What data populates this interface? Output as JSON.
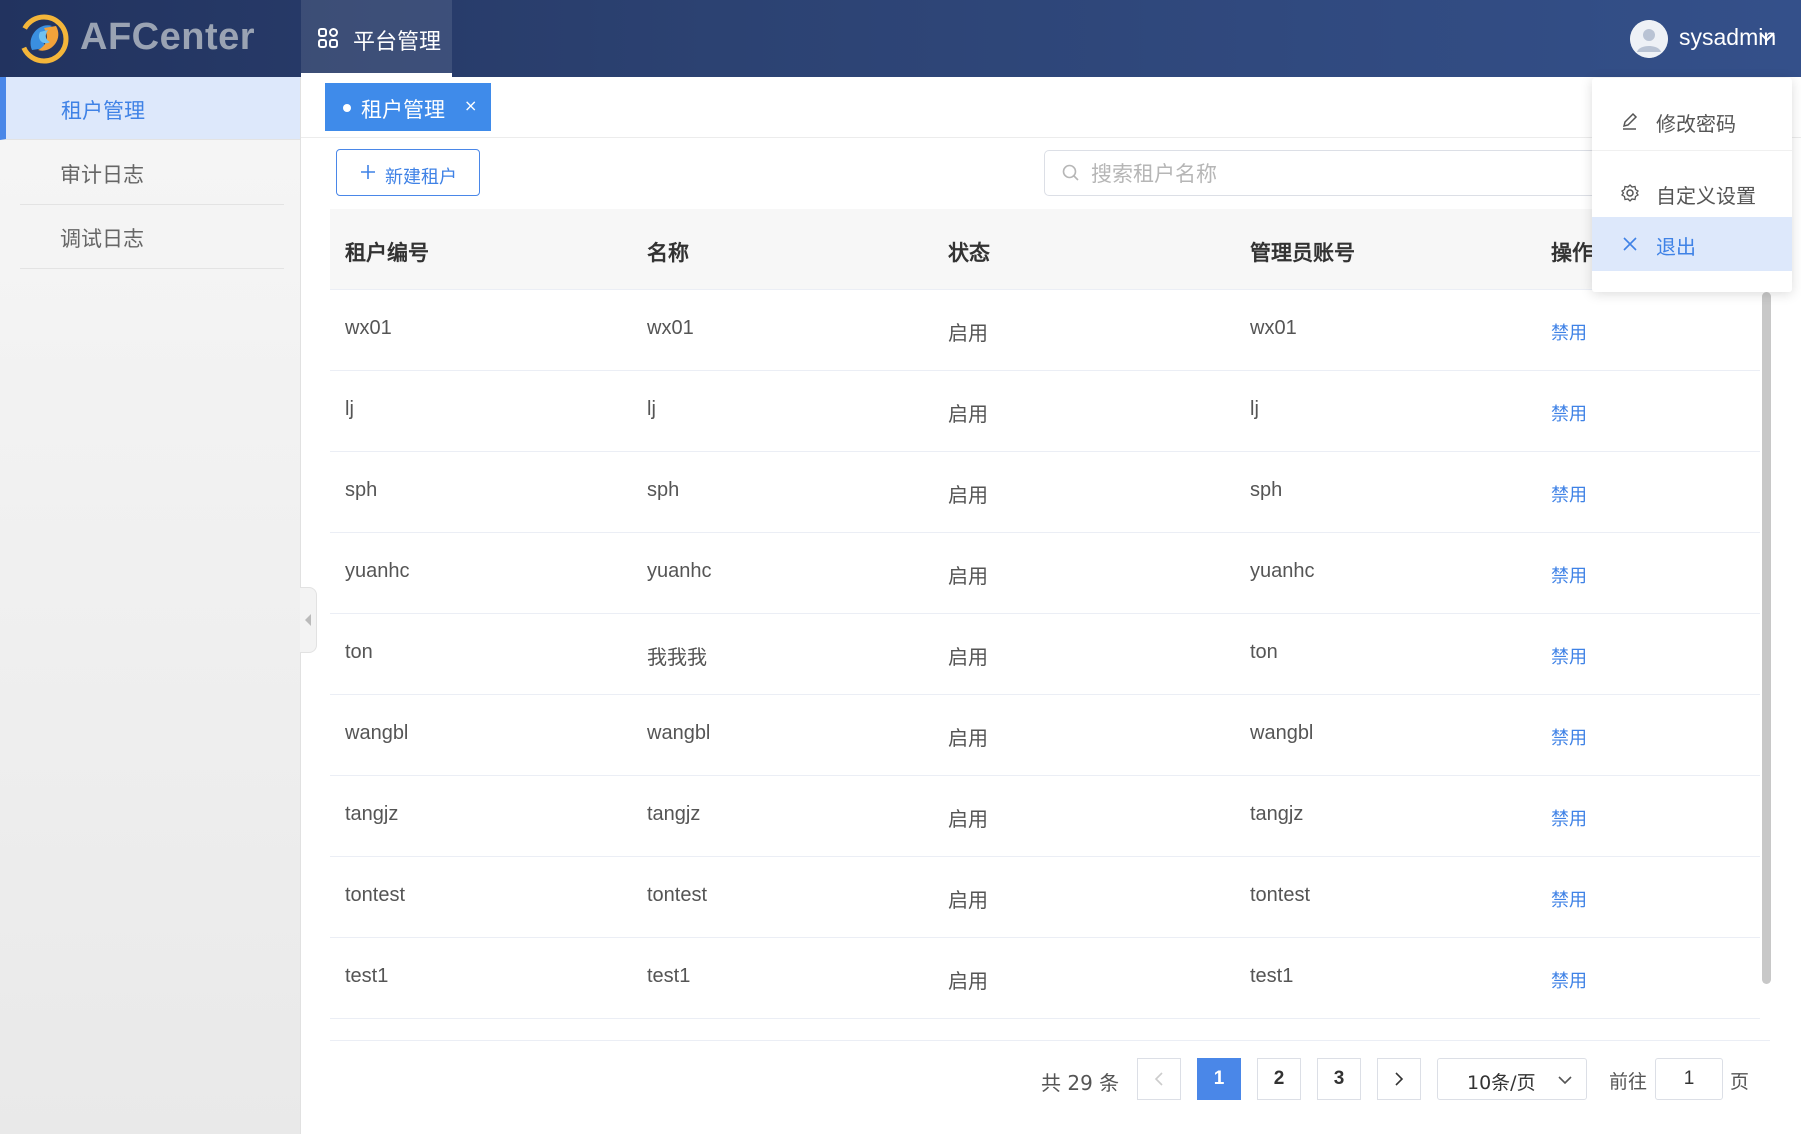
{
  "header": {
    "brand": "AFCenter",
    "nav_label": "平台管理",
    "username": "sysadmin"
  },
  "sidebar": {
    "items": [
      {
        "label": "租户管理",
        "active": true
      },
      {
        "label": "审计日志",
        "active": false
      },
      {
        "label": "调试日志",
        "active": false
      }
    ]
  },
  "tabs": {
    "active_label": "租户管理",
    "close_glyph": "×"
  },
  "toolbar": {
    "new_label": "新建租户",
    "search_placeholder": "搜索租户名称"
  },
  "table": {
    "headers": [
      "租户编号",
      "名称",
      "状态",
      "管理员账号",
      "操作"
    ],
    "rows": [
      {
        "id": "wx01",
        "name": "wx01",
        "status": "启用",
        "admin": "wx01",
        "action": "禁用"
      },
      {
        "id": "lj",
        "name": "lj",
        "status": "启用",
        "admin": "lj",
        "action": "禁用"
      },
      {
        "id": "sph",
        "name": "sph",
        "status": "启用",
        "admin": "sph",
        "action": "禁用"
      },
      {
        "id": "yuanhc",
        "name": "yuanhc",
        "status": "启用",
        "admin": "yuanhc",
        "action": "禁用"
      },
      {
        "id": "ton",
        "name": "我我我",
        "status": "启用",
        "admin": "ton",
        "action": "禁用"
      },
      {
        "id": "wangbl",
        "name": "wangbl",
        "status": "启用",
        "admin": "wangbl",
        "action": "禁用"
      },
      {
        "id": "tangjz",
        "name": "tangjz",
        "status": "启用",
        "admin": "tangjz",
        "action": "禁用"
      },
      {
        "id": "tontest",
        "name": "tontest",
        "status": "启用",
        "admin": "tontest",
        "action": "禁用"
      },
      {
        "id": "test1",
        "name": "test1",
        "status": "启用",
        "admin": "test1",
        "action": "禁用"
      }
    ]
  },
  "pagination": {
    "total_text": "共 29 条",
    "pages": [
      "1",
      "2",
      "3"
    ],
    "current_page": "1",
    "page_size": "10条/页",
    "goto_label": "前往",
    "goto_value": "1",
    "page_suffix": "页"
  },
  "user_menu": {
    "items": [
      {
        "label": "修改密码",
        "icon": "edit-icon"
      },
      {
        "label": "自定义设置",
        "icon": "gear-icon"
      },
      {
        "label": "退出",
        "icon": "close-icon"
      }
    ]
  },
  "colors": {
    "accent": "#4a87e8",
    "header_start": "#22335f",
    "header_end": "#34508a",
    "active_bg": "#dde8fb"
  }
}
